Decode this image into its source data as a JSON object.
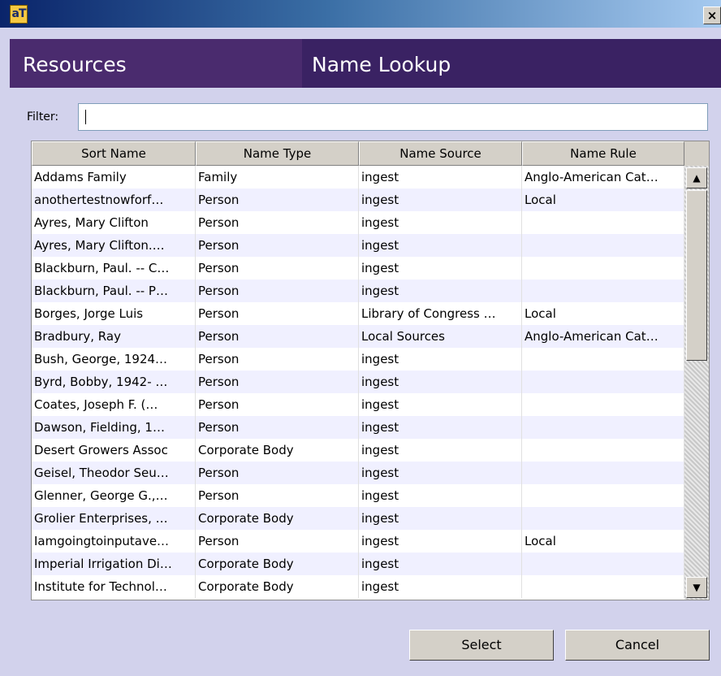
{
  "window": {
    "app_icon": "aT",
    "close_label": "×"
  },
  "header": {
    "section": "Resources",
    "title": "Name Lookup"
  },
  "filter": {
    "label": "Filter:",
    "value": ""
  },
  "table": {
    "columns": [
      "Sort Name",
      "Name Type",
      "Name Source",
      "Name Rule"
    ],
    "rows": [
      [
        "Addams Family",
        "Family",
        "ingest",
        "Anglo-American Cat…"
      ],
      [
        "anothertestnowforf…",
        "Person",
        "ingest",
        "Local"
      ],
      [
        "Ayres, Mary Clifton",
        "Person",
        "ingest",
        ""
      ],
      [
        "Ayres, Mary Clifton.…",
        "Person",
        "ingest",
        ""
      ],
      [
        "Blackburn, Paul. -- C…",
        "Person",
        "ingest",
        ""
      ],
      [
        "Blackburn, Paul. -- P…",
        "Person",
        "ingest",
        ""
      ],
      [
        "Borges, Jorge Luis",
        "Person",
        "Library of Congress …",
        "Local"
      ],
      [
        "Bradbury, Ray",
        "Person",
        "Local Sources",
        "Anglo-American Cat…"
      ],
      [
        "Bush, George, 1924…",
        "Person",
        "ingest",
        ""
      ],
      [
        "Byrd, Bobby, 1942- …",
        "Person",
        "ingest",
        ""
      ],
      [
        "Coates, Joseph F. (…",
        "Person",
        "ingest",
        ""
      ],
      [
        "Dawson, Fielding, 1…",
        "Person",
        "ingest",
        ""
      ],
      [
        "Desert Growers Assoc",
        "Corporate Body",
        "ingest",
        ""
      ],
      [
        "Geisel, Theodor Seu…",
        "Person",
        "ingest",
        ""
      ],
      [
        "Glenner, George G.,…",
        "Person",
        "ingest",
        ""
      ],
      [
        "Grolier Enterprises, …",
        "Corporate Body",
        "ingest",
        ""
      ],
      [
        "Iamgoingtoinputave…",
        "Person",
        "ingest",
        "Local"
      ],
      [
        "Imperial Irrigation Di…",
        "Corporate Body",
        "ingest",
        ""
      ],
      [
        "Institute for Technol…",
        "Corporate Body",
        "ingest",
        ""
      ]
    ]
  },
  "buttons": {
    "select": "Select",
    "cancel": "Cancel"
  },
  "colors": {
    "header_bg": "#4a2b6e",
    "body_bg": "#d2d2ec",
    "title_gradient_start": "#0a246a"
  }
}
